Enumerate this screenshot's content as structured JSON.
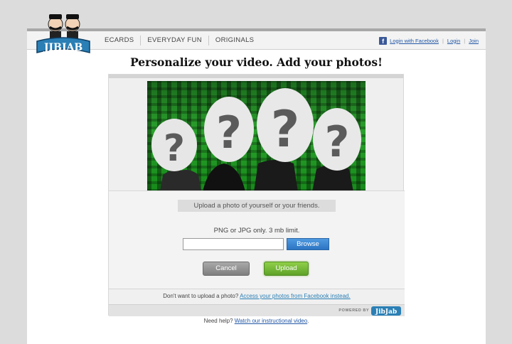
{
  "brand": {
    "logo_text": "JIBJAB",
    "powered_by": "POWERED BY",
    "powered_logo_text": "JibJab"
  },
  "nav": {
    "items": [
      "ECARDS",
      "EVERYDAY FUN",
      "ORIGINALS"
    ]
  },
  "auth": {
    "facebook_login": "Login with Facebook",
    "login": "Login",
    "join": "Join",
    "separator": "|"
  },
  "page": {
    "title": "Personalize your video. Add your photos!"
  },
  "upload": {
    "prompt": "Upload a photo of yourself or your friends.",
    "limit": "PNG or JPG only.  3 mb limit.",
    "file_value": "",
    "browse_label": "Browse",
    "cancel_label": "Cancel",
    "upload_label": "Upload"
  },
  "facebook_alt": {
    "text": "Don't want to upload a photo?",
    "link": "Access your photos from Facebook instead."
  },
  "help": {
    "text": "Need help?",
    "link": "Watch our instructional video",
    "suffix": "."
  },
  "colors": {
    "accent_blue": "#2c74c4",
    "accent_green": "#5ea228",
    "facebook": "#3b5998"
  },
  "icons": [
    "jibjab-logo",
    "facebook-icon",
    "question-mark-face-icon"
  ]
}
